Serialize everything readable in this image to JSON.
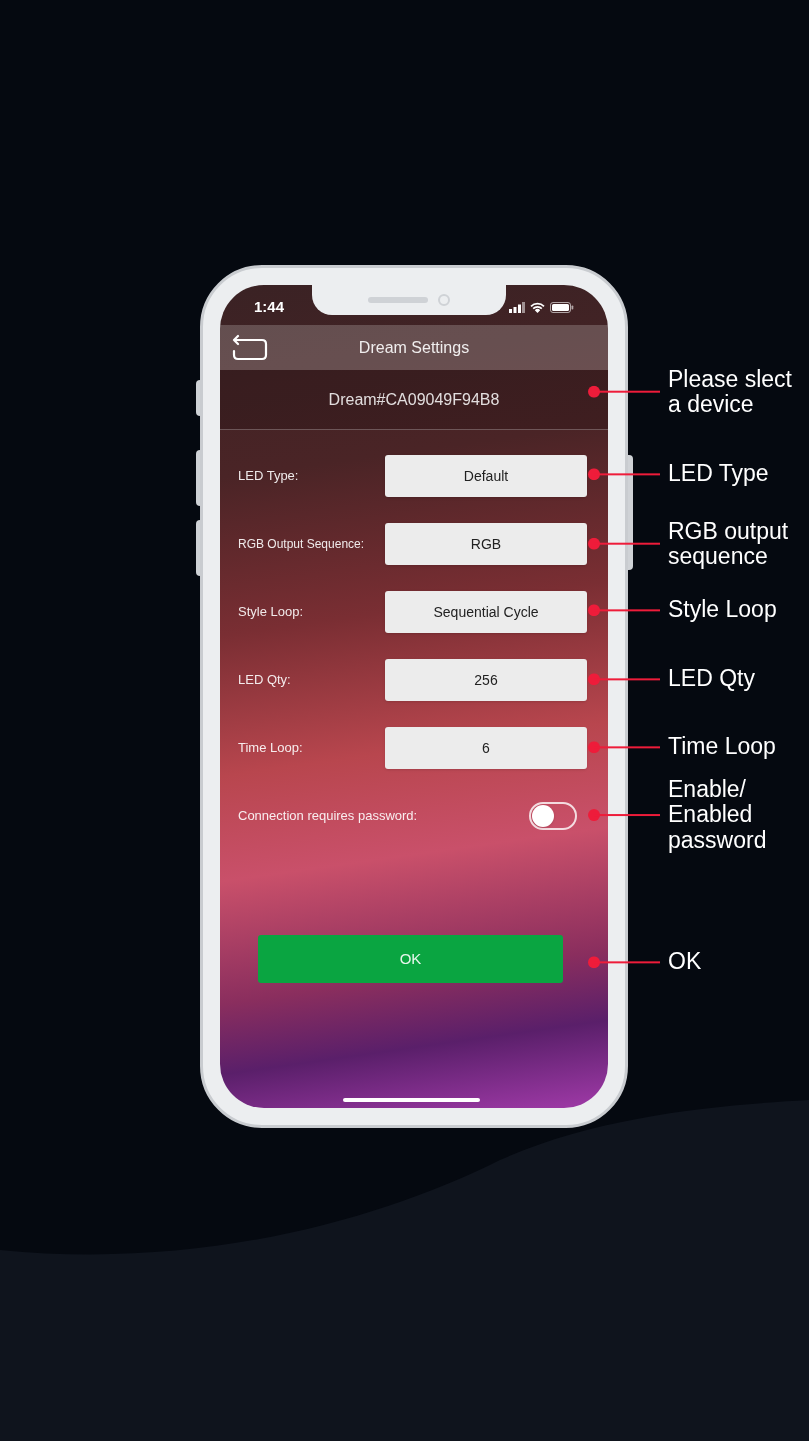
{
  "status_bar": {
    "time": "1:44"
  },
  "header": {
    "title": "Dream Settings"
  },
  "device": {
    "name": "Dream#CA09049F94B8"
  },
  "settings": [
    {
      "kind": "select",
      "label": "LED Type:",
      "value": "Default"
    },
    {
      "kind": "select",
      "label": "RGB Output Sequence:",
      "value": "RGB"
    },
    {
      "kind": "select",
      "label": "Style Loop:",
      "value": "Sequential Cycle"
    },
    {
      "kind": "select",
      "label": "LED Qty:",
      "value": "256"
    },
    {
      "kind": "select",
      "label": "Time Loop:",
      "value": "6"
    },
    {
      "kind": "toggle",
      "label": "Connection requires password:",
      "on": false
    }
  ],
  "ok_button": {
    "label": "OK"
  },
  "callouts": [
    "Please slect a device",
    "LED Type",
    "RGB output sequence",
    "Style Loop",
    "LED Qty",
    "Time Loop",
    "Enable/ Enabled password",
    "OK"
  ]
}
